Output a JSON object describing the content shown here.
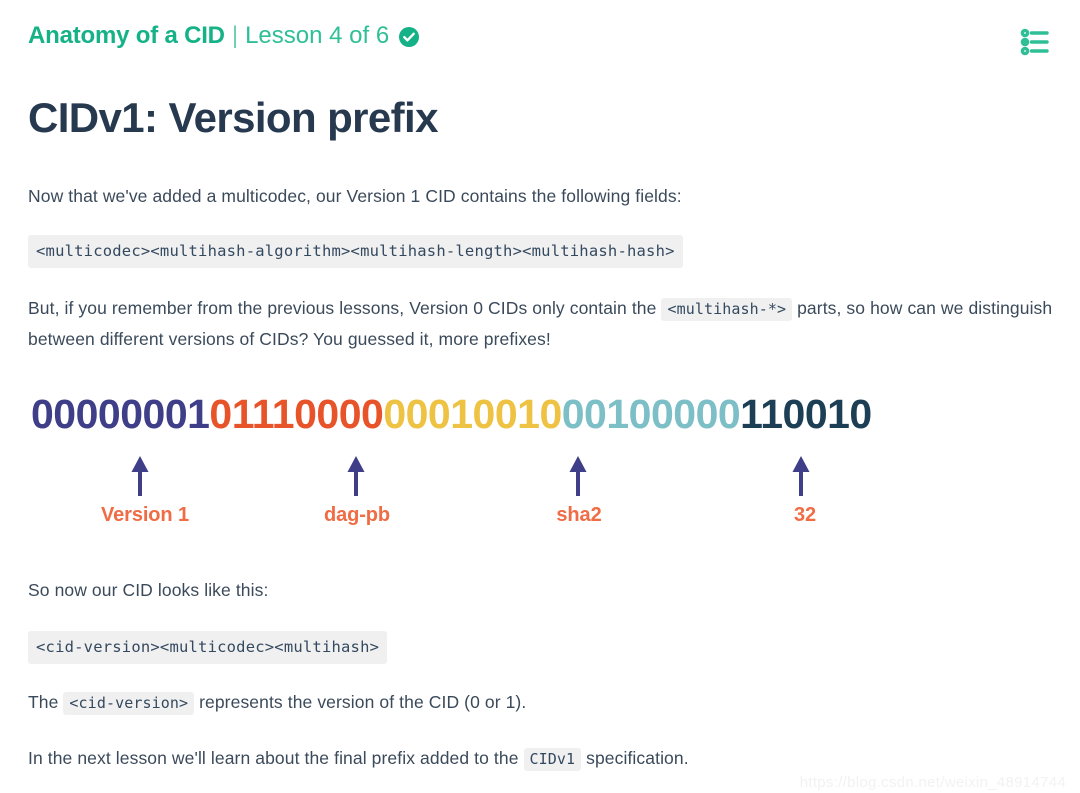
{
  "header": {
    "course_title": "Anatomy of a CID",
    "separator": "|",
    "lesson_label": "Lesson 4 of 6",
    "completed_icon": "check-circle-icon",
    "menu_icon": "list-menu-icon",
    "brand_color": "#15b187"
  },
  "page": {
    "title": "CIDv1: Version prefix"
  },
  "body": {
    "para_1": "Now that we've added a multicodec, our Version 1 CID contains the following fields:",
    "code_block_1": "<multicodec><multihash-algorithm><multihash-length><multihash-hash>",
    "para_2_part_1": "But, if you remember from the previous lessons, Version 0 CIDs only contain the ",
    "para_2_code": "<multihash-*>",
    "para_2_part_2": " parts, so how can we distinguish between different versions of CIDs? You guessed it, more prefixes!",
    "para_3": "So now our CID looks like this:",
    "code_block_2": "<cid-version><multicodec><multihash>",
    "para_4_part_1": "The ",
    "para_4_code": "<cid-version>",
    "para_4_part_2": " represents the version of the CID (0 or 1).",
    "para_5_part_1": "In the next lesson we'll learn about the final prefix added to the ",
    "para_5_code": "CIDv1",
    "para_5_part_2": " specification."
  },
  "binary_diagram": {
    "segments": [
      {
        "bits": "00000001",
        "color": "#3f3e88",
        "label": "Version 1",
        "has_arrow": true
      },
      {
        "bits": "01110000",
        "color": "#e8542a",
        "label": "dag-pb",
        "has_arrow": true
      },
      {
        "bits": "00010010",
        "color": "#eec243",
        "label": "sha2",
        "has_arrow": true
      },
      {
        "bits": "00100000",
        "color": "#7cbfc7",
        "label": "32",
        "has_arrow": true
      },
      {
        "bits": "110010",
        "color": "#1d3f56",
        "label": "",
        "has_arrow": false
      }
    ],
    "arrow_color": "#3f3e88",
    "label_color": "#ef6c45"
  },
  "watermark": {
    "text": "https://blog.csdn.net/weixin_48914744"
  }
}
